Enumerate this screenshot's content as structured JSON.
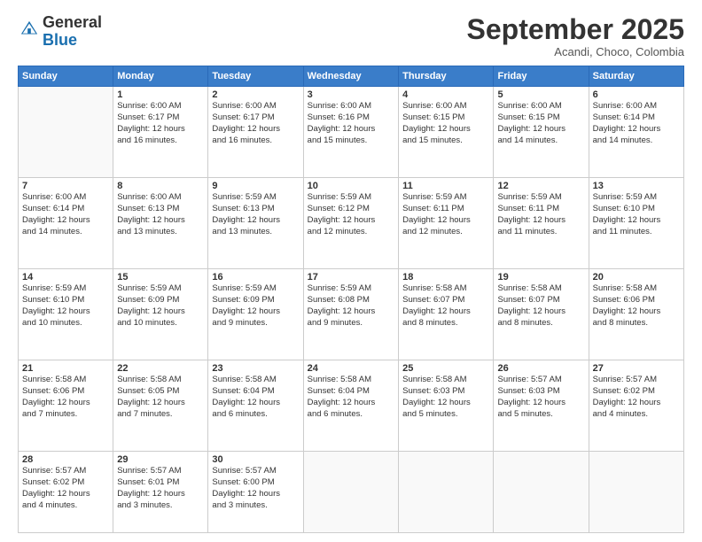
{
  "header": {
    "logo_general": "General",
    "logo_blue": "Blue",
    "month_title": "September 2025",
    "location": "Acandi, Choco, Colombia"
  },
  "days_of_week": [
    "Sunday",
    "Monday",
    "Tuesday",
    "Wednesday",
    "Thursday",
    "Friday",
    "Saturday"
  ],
  "weeks": [
    [
      {
        "day": "",
        "info": ""
      },
      {
        "day": "1",
        "info": "Sunrise: 6:00 AM\nSunset: 6:17 PM\nDaylight: 12 hours\nand 16 minutes."
      },
      {
        "day": "2",
        "info": "Sunrise: 6:00 AM\nSunset: 6:17 PM\nDaylight: 12 hours\nand 16 minutes."
      },
      {
        "day": "3",
        "info": "Sunrise: 6:00 AM\nSunset: 6:16 PM\nDaylight: 12 hours\nand 15 minutes."
      },
      {
        "day": "4",
        "info": "Sunrise: 6:00 AM\nSunset: 6:15 PM\nDaylight: 12 hours\nand 15 minutes."
      },
      {
        "day": "5",
        "info": "Sunrise: 6:00 AM\nSunset: 6:15 PM\nDaylight: 12 hours\nand 14 minutes."
      },
      {
        "day": "6",
        "info": "Sunrise: 6:00 AM\nSunset: 6:14 PM\nDaylight: 12 hours\nand 14 minutes."
      }
    ],
    [
      {
        "day": "7",
        "info": "Sunrise: 6:00 AM\nSunset: 6:14 PM\nDaylight: 12 hours\nand 14 minutes."
      },
      {
        "day": "8",
        "info": "Sunrise: 6:00 AM\nSunset: 6:13 PM\nDaylight: 12 hours\nand 13 minutes."
      },
      {
        "day": "9",
        "info": "Sunrise: 5:59 AM\nSunset: 6:13 PM\nDaylight: 12 hours\nand 13 minutes."
      },
      {
        "day": "10",
        "info": "Sunrise: 5:59 AM\nSunset: 6:12 PM\nDaylight: 12 hours\nand 12 minutes."
      },
      {
        "day": "11",
        "info": "Sunrise: 5:59 AM\nSunset: 6:11 PM\nDaylight: 12 hours\nand 12 minutes."
      },
      {
        "day": "12",
        "info": "Sunrise: 5:59 AM\nSunset: 6:11 PM\nDaylight: 12 hours\nand 11 minutes."
      },
      {
        "day": "13",
        "info": "Sunrise: 5:59 AM\nSunset: 6:10 PM\nDaylight: 12 hours\nand 11 minutes."
      }
    ],
    [
      {
        "day": "14",
        "info": "Sunrise: 5:59 AM\nSunset: 6:10 PM\nDaylight: 12 hours\nand 10 minutes."
      },
      {
        "day": "15",
        "info": "Sunrise: 5:59 AM\nSunset: 6:09 PM\nDaylight: 12 hours\nand 10 minutes."
      },
      {
        "day": "16",
        "info": "Sunrise: 5:59 AM\nSunset: 6:09 PM\nDaylight: 12 hours\nand 9 minutes."
      },
      {
        "day": "17",
        "info": "Sunrise: 5:59 AM\nSunset: 6:08 PM\nDaylight: 12 hours\nand 9 minutes."
      },
      {
        "day": "18",
        "info": "Sunrise: 5:58 AM\nSunset: 6:07 PM\nDaylight: 12 hours\nand 8 minutes."
      },
      {
        "day": "19",
        "info": "Sunrise: 5:58 AM\nSunset: 6:07 PM\nDaylight: 12 hours\nand 8 minutes."
      },
      {
        "day": "20",
        "info": "Sunrise: 5:58 AM\nSunset: 6:06 PM\nDaylight: 12 hours\nand 8 minutes."
      }
    ],
    [
      {
        "day": "21",
        "info": "Sunrise: 5:58 AM\nSunset: 6:06 PM\nDaylight: 12 hours\nand 7 minutes."
      },
      {
        "day": "22",
        "info": "Sunrise: 5:58 AM\nSunset: 6:05 PM\nDaylight: 12 hours\nand 7 minutes."
      },
      {
        "day": "23",
        "info": "Sunrise: 5:58 AM\nSunset: 6:04 PM\nDaylight: 12 hours\nand 6 minutes."
      },
      {
        "day": "24",
        "info": "Sunrise: 5:58 AM\nSunset: 6:04 PM\nDaylight: 12 hours\nand 6 minutes."
      },
      {
        "day": "25",
        "info": "Sunrise: 5:58 AM\nSunset: 6:03 PM\nDaylight: 12 hours\nand 5 minutes."
      },
      {
        "day": "26",
        "info": "Sunrise: 5:57 AM\nSunset: 6:03 PM\nDaylight: 12 hours\nand 5 minutes."
      },
      {
        "day": "27",
        "info": "Sunrise: 5:57 AM\nSunset: 6:02 PM\nDaylight: 12 hours\nand 4 minutes."
      }
    ],
    [
      {
        "day": "28",
        "info": "Sunrise: 5:57 AM\nSunset: 6:02 PM\nDaylight: 12 hours\nand 4 minutes."
      },
      {
        "day": "29",
        "info": "Sunrise: 5:57 AM\nSunset: 6:01 PM\nDaylight: 12 hours\nand 3 minutes."
      },
      {
        "day": "30",
        "info": "Sunrise: 5:57 AM\nSunset: 6:00 PM\nDaylight: 12 hours\nand 3 minutes."
      },
      {
        "day": "",
        "info": ""
      },
      {
        "day": "",
        "info": ""
      },
      {
        "day": "",
        "info": ""
      },
      {
        "day": "",
        "info": ""
      }
    ]
  ]
}
